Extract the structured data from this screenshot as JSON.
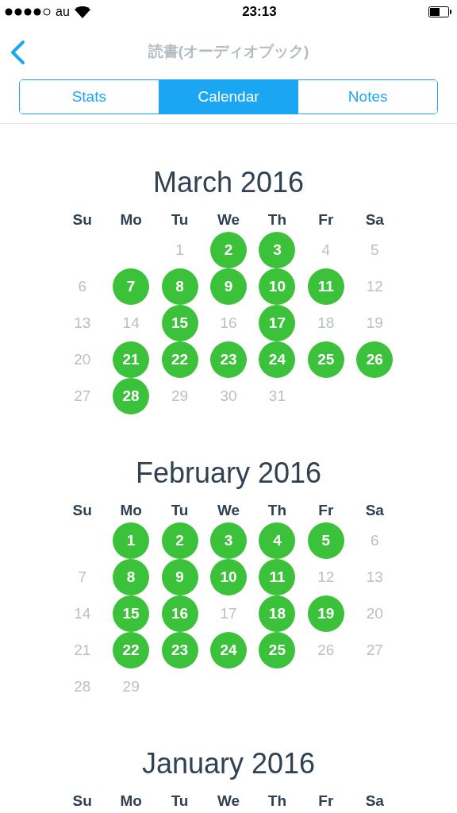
{
  "status_bar": {
    "carrier": "au",
    "time": "23:13"
  },
  "nav": {
    "title": "読書(オーディオブック)"
  },
  "tabs": [
    {
      "label": "Stats",
      "selected": false
    },
    {
      "label": "Calendar",
      "selected": true
    },
    {
      "label": "Notes",
      "selected": false
    }
  ],
  "months": [
    {
      "title": "March 2016",
      "weekdays": [
        "Su",
        "Mo",
        "Tu",
        "We",
        "Th",
        "Fr",
        "Sa"
      ],
      "weeks": [
        {
          "kind": "lead",
          "days": [
            {
              "label": "1",
              "done": false
            },
            {
              "label": "2",
              "done": true
            },
            {
              "label": "3",
              "done": true
            },
            {
              "label": "4",
              "done": false
            },
            {
              "label": "5",
              "done": false
            }
          ]
        },
        {
          "kind": "full",
          "days": [
            {
              "label": "6",
              "done": false
            },
            {
              "label": "7",
              "done": true
            },
            {
              "label": "8",
              "done": true
            },
            {
              "label": "9",
              "done": true
            },
            {
              "label": "10",
              "done": true
            },
            {
              "label": "11",
              "done": true
            },
            {
              "label": "12",
              "done": false
            }
          ]
        },
        {
          "kind": "full",
          "days": [
            {
              "label": "13",
              "done": false
            },
            {
              "label": "14",
              "done": false
            },
            {
              "label": "15",
              "done": true
            },
            {
              "label": "16",
              "done": false
            },
            {
              "label": "17",
              "done": true
            },
            {
              "label": "18",
              "done": false
            },
            {
              "label": "19",
              "done": false
            }
          ]
        },
        {
          "kind": "full",
          "days": [
            {
              "label": "20",
              "done": false
            },
            {
              "label": "21",
              "done": true
            },
            {
              "label": "22",
              "done": true
            },
            {
              "label": "23",
              "done": true
            },
            {
              "label": "24",
              "done": true
            },
            {
              "label": "25",
              "done": true
            },
            {
              "label": "26",
              "done": true
            }
          ]
        },
        {
          "kind": "trail",
          "days": [
            {
              "label": "27",
              "done": false
            },
            {
              "label": "28",
              "done": true
            },
            {
              "label": "29",
              "done": false
            },
            {
              "label": "30",
              "done": false
            },
            {
              "label": "31",
              "done": false
            }
          ]
        }
      ]
    },
    {
      "title": "February 2016",
      "weekdays": [
        "Su",
        "Mo",
        "Tu",
        "We",
        "Th",
        "Fr",
        "Sa"
      ],
      "weeks": [
        {
          "kind": "lead",
          "days": [
            {
              "label": "1",
              "done": true
            },
            {
              "label": "2",
              "done": true
            },
            {
              "label": "3",
              "done": true
            },
            {
              "label": "4",
              "done": true
            },
            {
              "label": "5",
              "done": true
            },
            {
              "label": "6",
              "done": false
            }
          ]
        },
        {
          "kind": "full",
          "days": [
            {
              "label": "7",
              "done": false
            },
            {
              "label": "8",
              "done": true
            },
            {
              "label": "9",
              "done": true
            },
            {
              "label": "10",
              "done": true
            },
            {
              "label": "11",
              "done": true
            },
            {
              "label": "12",
              "done": false
            },
            {
              "label": "13",
              "done": false
            }
          ]
        },
        {
          "kind": "full",
          "days": [
            {
              "label": "14",
              "done": false
            },
            {
              "label": "15",
              "done": true
            },
            {
              "label": "16",
              "done": true
            },
            {
              "label": "17",
              "done": false
            },
            {
              "label": "18",
              "done": true
            },
            {
              "label": "19",
              "done": true
            },
            {
              "label": "20",
              "done": false
            }
          ]
        },
        {
          "kind": "full",
          "days": [
            {
              "label": "21",
              "done": false
            },
            {
              "label": "22",
              "done": true
            },
            {
              "label": "23",
              "done": true
            },
            {
              "label": "24",
              "done": true
            },
            {
              "label": "25",
              "done": true
            },
            {
              "label": "26",
              "done": false
            },
            {
              "label": "27",
              "done": false
            }
          ]
        },
        {
          "kind": "trail",
          "days": [
            {
              "label": "28",
              "done": false
            },
            {
              "label": "29",
              "done": false
            }
          ]
        }
      ]
    },
    {
      "title": "January 2016",
      "weekdays": [
        "Su",
        "Mo",
        "Tu",
        "We",
        "Th",
        "Fr",
        "Sa"
      ]
    }
  ]
}
